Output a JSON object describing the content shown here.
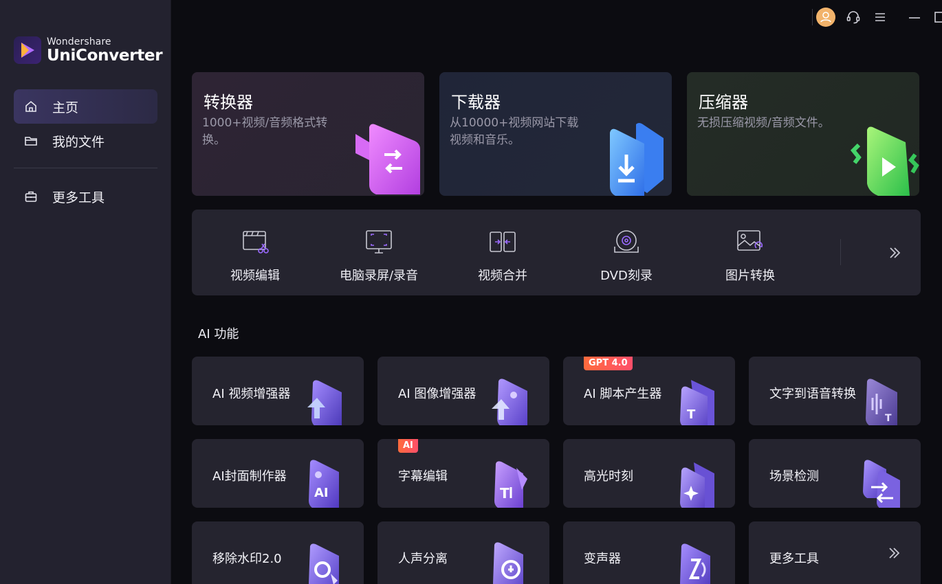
{
  "app": {
    "brand_sub": "Wondershare",
    "brand_main": "UniConverter"
  },
  "sidebar": {
    "items": [
      {
        "label": "主页",
        "icon": "home-icon",
        "active": true
      },
      {
        "label": "我的文件",
        "icon": "folder-icon",
        "active": false
      },
      {
        "label": "更多工具",
        "icon": "toolbox-icon",
        "active": false
      }
    ]
  },
  "titlebar": {
    "icons": [
      "user-avatar-icon",
      "headset-icon",
      "menu-icon",
      "minimize-icon",
      "maximize-icon",
      "close-icon"
    ]
  },
  "top_cards": [
    {
      "title": "转换器",
      "desc": "1000+视频/音频格式转换。",
      "color": "#2f2735",
      "icon": "converter-icon"
    },
    {
      "title": "下载器",
      "desc": "从10000+视频网站下载视频和音乐。",
      "color": "#222738",
      "icon": "downloader-icon"
    },
    {
      "title": "压缩器",
      "desc": "无损压缩视频/音频文件。",
      "color": "#242c27",
      "icon": "compressor-icon"
    }
  ],
  "tools": [
    {
      "label": "视频编辑",
      "icon": "video-edit-icon"
    },
    {
      "label": "电脑录屏/录音",
      "icon": "screen-record-icon"
    },
    {
      "label": "视频合并",
      "icon": "video-merge-icon"
    },
    {
      "label": "DVD刻录",
      "icon": "dvd-burn-icon"
    },
    {
      "label": "图片转换",
      "icon": "image-convert-icon"
    }
  ],
  "ai_section": {
    "title": "AI 功能",
    "cards": [
      {
        "label": "AI 视频增强器",
        "badge": ""
      },
      {
        "label": "AI 图像增强器",
        "badge": ""
      },
      {
        "label": "AI 脚本产生器",
        "badge": "GPT 4.0"
      },
      {
        "label": "文字到语音转换",
        "badge": ""
      },
      {
        "label": "AI封面制作器",
        "badge": ""
      },
      {
        "label": "字幕编辑",
        "badge": "AI"
      },
      {
        "label": "高光时刻",
        "badge": ""
      },
      {
        "label": "场景检测",
        "badge": ""
      },
      {
        "label": "移除水印2.0",
        "badge": ""
      },
      {
        "label": "人声分离",
        "badge": ""
      },
      {
        "label": "变声器",
        "badge": ""
      },
      {
        "label": "更多工具",
        "badge": ""
      }
    ]
  },
  "colors": {
    "accent": "#8b6cf0",
    "sidebar_bg": "#23222f",
    "main_bg": "#0c0c11",
    "card_bg": "#25242f",
    "badge": "#ff5a4f"
  }
}
